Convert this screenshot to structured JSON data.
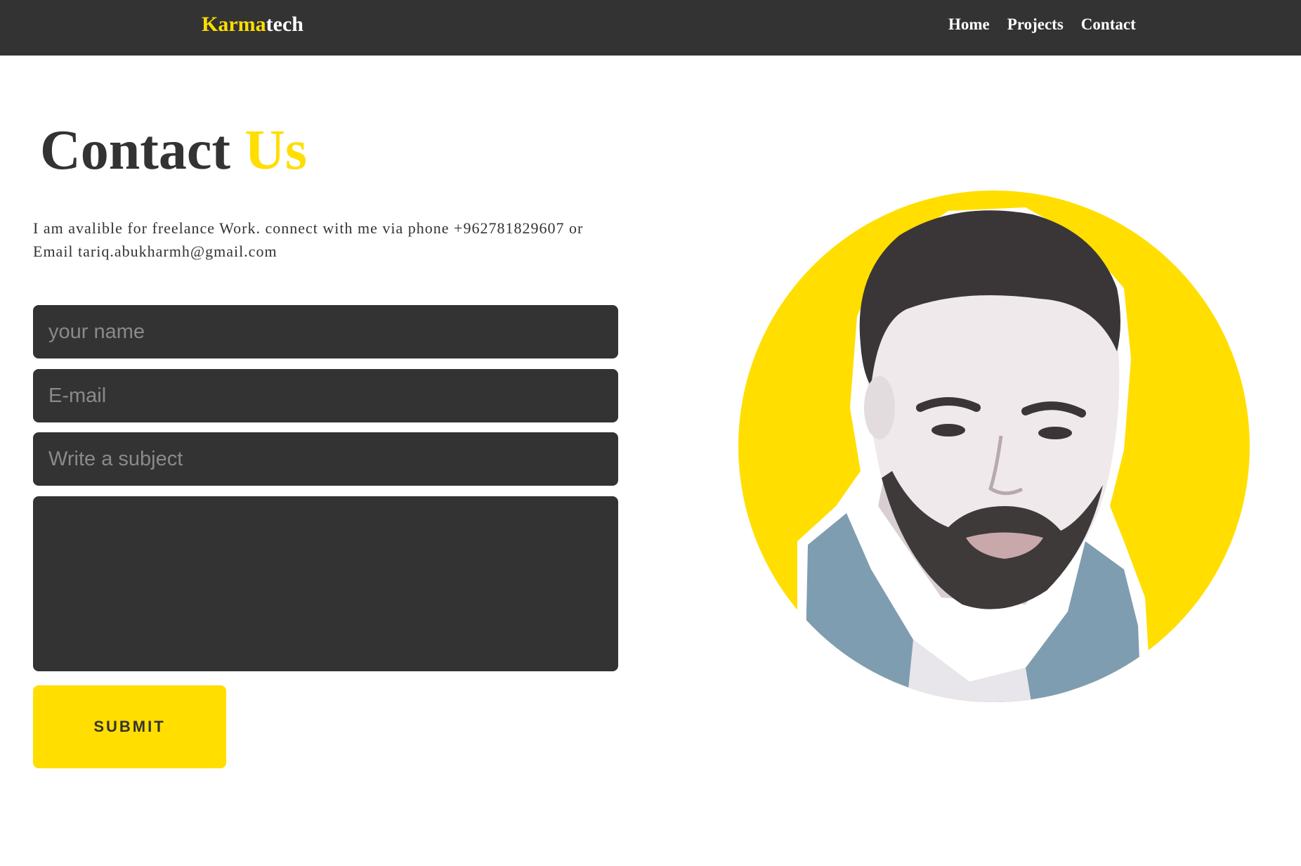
{
  "header": {
    "logo_accent": "Karma",
    "logo_rest": "tech",
    "nav": [
      {
        "label": "Home"
      },
      {
        "label": "Projects"
      },
      {
        "label": "Contact"
      }
    ]
  },
  "main": {
    "title_main": "Contact",
    "title_accent": "Us",
    "intro": "I am avalible for freelance Work. connect with me via phone +962781829607 or Email tariq.abukharmh@gmail.com"
  },
  "form": {
    "name_placeholder": "your name",
    "email_placeholder": "E-mail",
    "subject_placeholder": "Write a subject",
    "message_placeholder": "",
    "submit_label": "SUBMIT"
  },
  "colors": {
    "accent": "#FFDE00",
    "dark": "#333333",
    "background": "#FFFFFF"
  },
  "profile_image": {
    "icon": "profile-photo"
  }
}
